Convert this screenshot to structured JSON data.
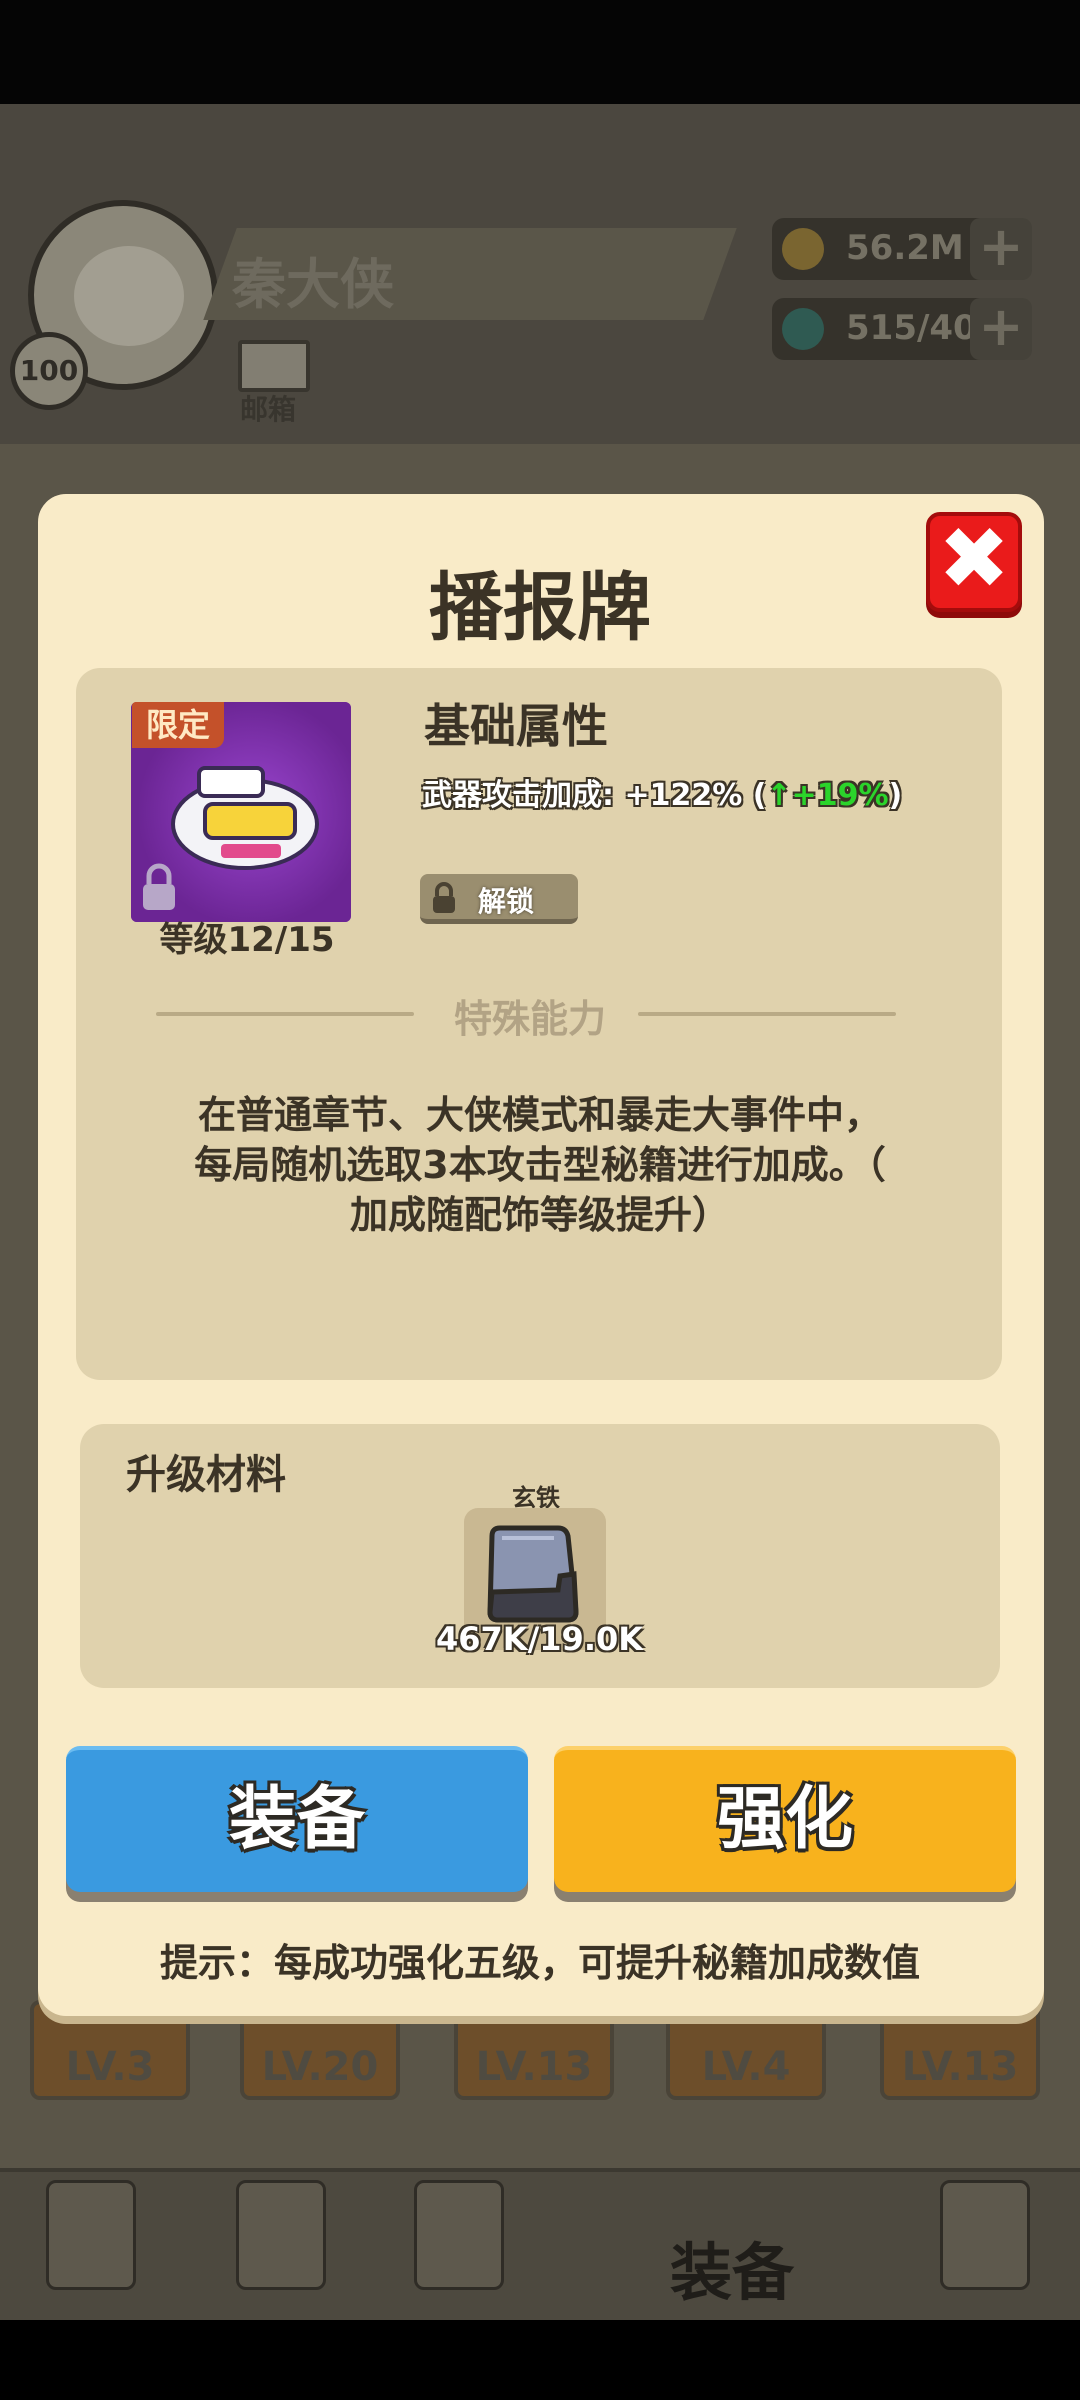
{
  "background": {
    "player_name": "秦大侠",
    "player_level": "100",
    "mail_label": "邮箱",
    "coins": "56.2M",
    "gems": "515/40",
    "plus_label": "+",
    "card_levels": [
      "LV.3",
      "LV.20",
      "LV.13",
      "LV.4",
      "LV.13"
    ],
    "nav_equip_label": "装备"
  },
  "modal": {
    "title": "播报牌",
    "close_symbol": "✖",
    "item": {
      "badge": "限定",
      "level": "等级12/15"
    },
    "base": {
      "title": "基础属性",
      "stat_label": "武器攻击加成: +122% (",
      "stat_up": "↑+19%",
      "stat_close": ")",
      "unlock_label": "解锁"
    },
    "special": {
      "title": "特殊能力",
      "lines": [
        "在普通章节、大侠模式和暴走大事件中，",
        "每局随机选取3本攻击型秘籍进行加成。（",
        "加成随配饰等级提升）"
      ]
    },
    "material": {
      "title": "升级材料",
      "name": "玄铁",
      "count": "467K/19.0K"
    },
    "buttons": {
      "equip": "装备",
      "enhance": "强化"
    },
    "tip": "提示：每成功强化五级，可提升秘籍加成数值"
  },
  "colors": {
    "modal_bg": "#f9ebc8",
    "panel_bg": "#e0d2ad",
    "equip_button": "#3a9ae0",
    "enhance_button": "#f8b21d",
    "close_button": "#ea1b1b",
    "stat_up": "#2bd42b"
  }
}
